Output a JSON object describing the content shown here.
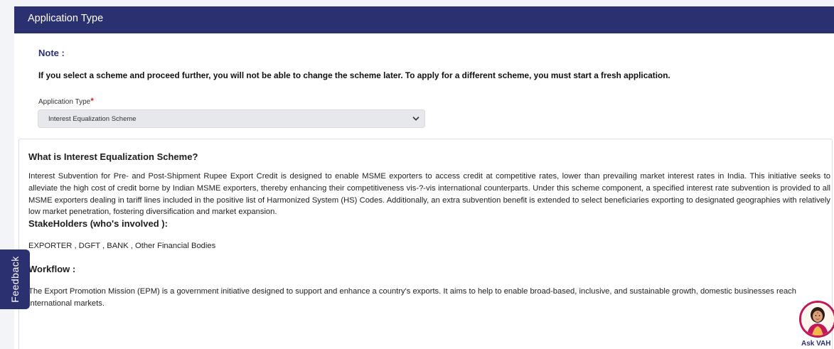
{
  "header": {
    "title": "Application Type"
  },
  "note": {
    "label": "Note :",
    "text": "If you select a scheme and proceed further, you will not be able to change the scheme later. To apply for a different scheme, you must start a fresh application."
  },
  "application_type_field": {
    "label": "Application Type",
    "required_marker": "*",
    "selected_value": "Interest Equalization Scheme"
  },
  "info_panel": {
    "what_heading": "What is Interest Equalization Scheme?",
    "what_text": "Interest Subvention for Pre- and Post-Shipment Rupee Export Credit is designed to enable MSME exporters to access credit at competitive rates, lower than prevailing market interest rates in India. This initiative seeks to alleviate the high cost of credit borne by Indian MSME exporters, thereby enhancing their competitiveness vis-?-vis international counterparts. Under this scheme component, a specified interest rate subvention is provided to all MSME exporters dealing in tariff lines included in the positive list of Harmonized System (HS) Codes. Additionally, an extra subvention benefit is extended to select beneficiaries exporting to designated geographies with relatively low market penetration, fostering diversification and market expansion.",
    "stakeholders_heading": "StakeHolders (who's involved ):",
    "stakeholders_text": "EXPORTER , DGFT , BANK , Other Financial Bodies",
    "workflow_heading": "Workflow :",
    "workflow_text": "The Export Promotion Mission (EPM) is a government initiative designed to support and enhance a country's exports. It aims to help to enable broad-based, inclusive, and sustainable growth, domestic businesses reach international markets."
  },
  "feedback_tab": {
    "label": "Feedback"
  },
  "assistant": {
    "label": "Ask VAH"
  },
  "colors": {
    "header_bg": "#2b3070",
    "accent": "#2b3070",
    "required": "#d62c2c",
    "assistant_ring": "#c2185b"
  }
}
